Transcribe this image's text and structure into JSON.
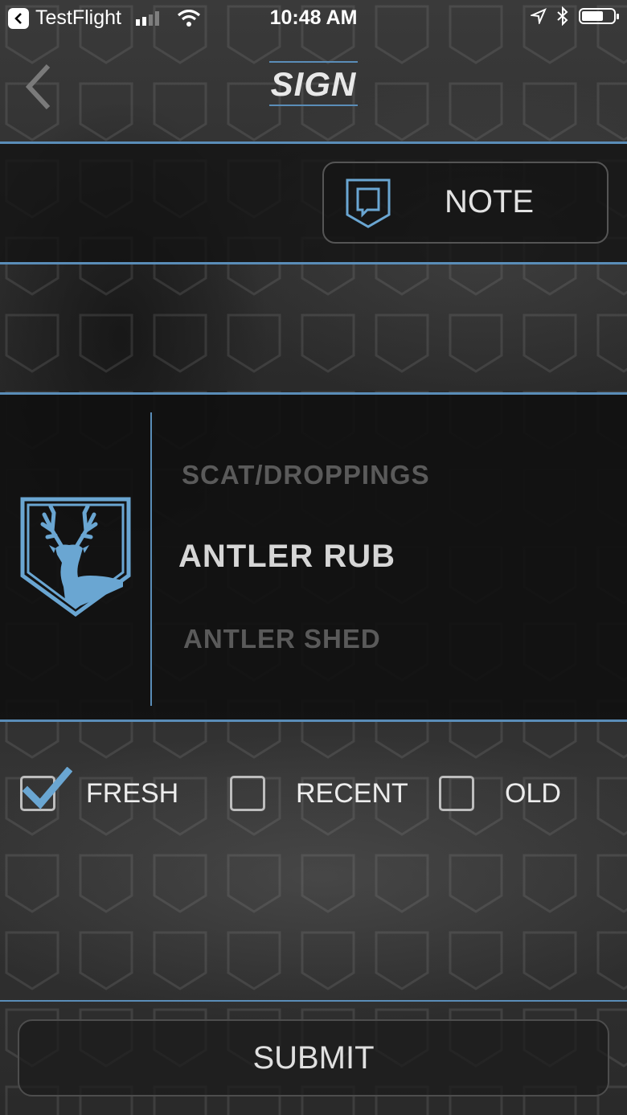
{
  "status_bar": {
    "carrier": "TestFlight",
    "time": "10:48 AM",
    "icons": [
      "signal-icon",
      "wifi-icon",
      "location-arrow-icon",
      "bluetooth-icon",
      "battery-icon"
    ]
  },
  "nav": {
    "title": "SIGN",
    "back_icon": "chevron-left-icon"
  },
  "note_button": {
    "label": "NOTE",
    "icon": "note-shield-icon"
  },
  "sign_picker": {
    "icon": "deer-shield-icon",
    "items": [
      "SCAT/DROPPINGS",
      "ANTLER RUB",
      "ANTLER SHED"
    ],
    "selected": "ANTLER RUB"
  },
  "freshness": {
    "options": [
      {
        "label": "FRESH",
        "checked": true
      },
      {
        "label": "RECENT",
        "checked": false
      },
      {
        "label": "OLD",
        "checked": false
      }
    ]
  },
  "submit": {
    "label": "SUBMIT"
  },
  "colors": {
    "accent": "#5a8db8",
    "icon_blue": "#6aa6d2",
    "panel": "#121212"
  }
}
